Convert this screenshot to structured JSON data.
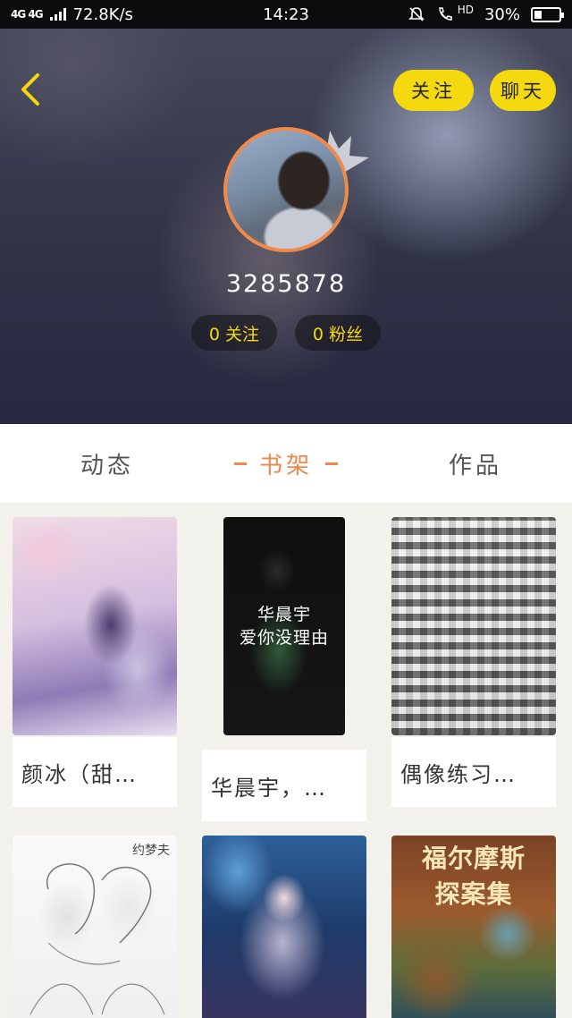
{
  "status_bar": {
    "network": "4G 4G",
    "speed": "72.8K/s",
    "time": "14:23",
    "hd": "HD",
    "battery": "30%",
    "battery_level": 0.3
  },
  "header": {
    "follow_button": "关注",
    "chat_button": "聊天",
    "username": "3285878",
    "following_chip": "0 关注",
    "fans_chip": "0 粉丝",
    "accent_color": "#f5d90f",
    "avatar_ring_color": "#f08a4b"
  },
  "tabs": [
    {
      "label": "动态",
      "active": false
    },
    {
      "label": "书架",
      "active": true
    },
    {
      "label": "作品",
      "active": false
    }
  ],
  "books": [
    {
      "title": "颜冰（甜…",
      "cover_text": ""
    },
    {
      "title": "华晨宇，…",
      "cover_text": "华晨宇\n爱你没理由"
    },
    {
      "title": "偶像练习…",
      "cover_text": ""
    },
    {
      "title": "",
      "cover_text": "约梦夫"
    },
    {
      "title": "",
      "cover_text": ""
    },
    {
      "title": "",
      "cover_text": "福尔摩斯\n探案集"
    }
  ]
}
